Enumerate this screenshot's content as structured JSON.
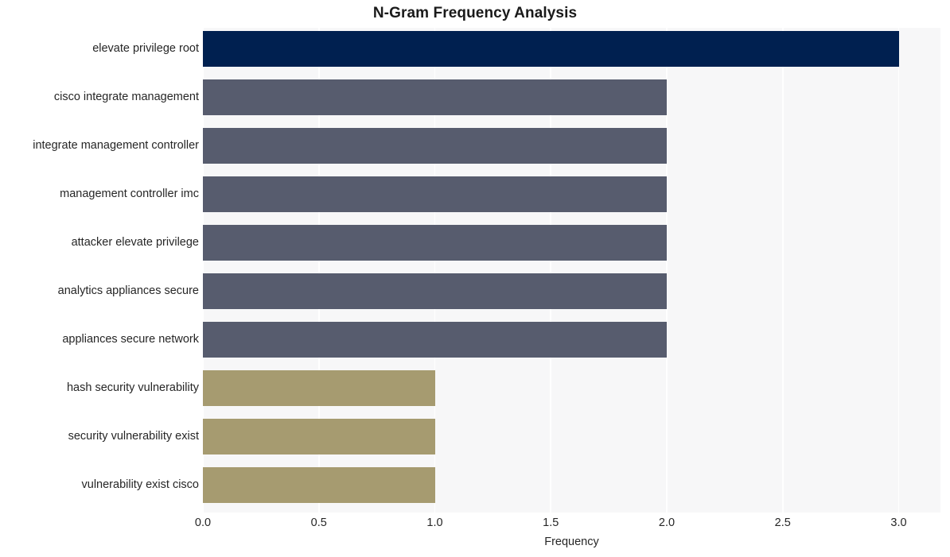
{
  "chart_data": {
    "type": "bar",
    "orientation": "horizontal",
    "title": "N-Gram Frequency Analysis",
    "xlabel": "Frequency",
    "ylabel": "",
    "categories": [
      "elevate privilege root",
      "cisco integrate management",
      "integrate management controller",
      "management controller imc",
      "attacker elevate privilege",
      "analytics appliances secure",
      "appliances secure network",
      "hash security vulnerability",
      "security vulnerability exist",
      "vulnerability exist cisco"
    ],
    "values": [
      3,
      2,
      2,
      2,
      2,
      2,
      2,
      1,
      1,
      1
    ],
    "bar_colors": [
      "#002050",
      "#575c6e",
      "#575c6e",
      "#575c6e",
      "#575c6e",
      "#575c6e",
      "#575c6e",
      "#a69b70",
      "#a69b70",
      "#a69b70"
    ],
    "xlim": [
      0,
      3.18
    ],
    "xticks": [
      0,
      0.5,
      1,
      1.5,
      2,
      2.5,
      3
    ],
    "xtick_labels": [
      "0.0",
      "0.5",
      "1.0",
      "1.5",
      "2.0",
      "2.5",
      "3.0"
    ],
    "grid": true,
    "grid_axis": "x",
    "grid_color": "#ffffff",
    "plot_background": "#f7f7f8",
    "figure_background": "#ffffff",
    "legend": null
  }
}
